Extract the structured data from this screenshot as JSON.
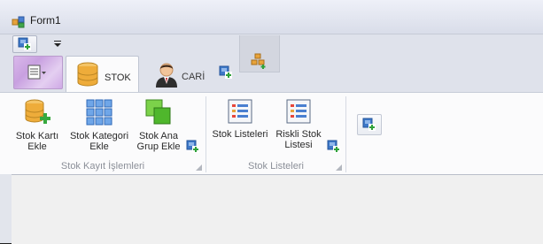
{
  "window": {
    "title": "Form1"
  },
  "tabs": [
    {
      "label": "STOK",
      "icon": "database-icon",
      "active": true
    },
    {
      "label": "CARİ",
      "icon": "businessman-icon",
      "active": false
    }
  ],
  "ribbon": {
    "groups": [
      {
        "caption": "Stok Kayıt İşlemleri",
        "buttons": [
          {
            "label": "Stok Kartı\nEkle",
            "icon": "database-add-icon"
          },
          {
            "label": "Stok Kategori\nEkle",
            "icon": "grid-icon"
          },
          {
            "label": "Stok Ana\nGrup Ekle",
            "icon": "green-squares-icon"
          }
        ]
      },
      {
        "caption": "Stok Listeleri",
        "buttons": [
          {
            "label": "Stok Listeleri",
            "icon": "list-icon"
          },
          {
            "label": "Riskli Stok\nListesi",
            "icon": "list-icon"
          }
        ]
      }
    ]
  },
  "colors": {
    "ribbon_bg": "#fbfbfc",
    "strip_bg": "#dfe2eb",
    "app_menu": "#d4b1e8",
    "caption": "#8b8f98"
  }
}
